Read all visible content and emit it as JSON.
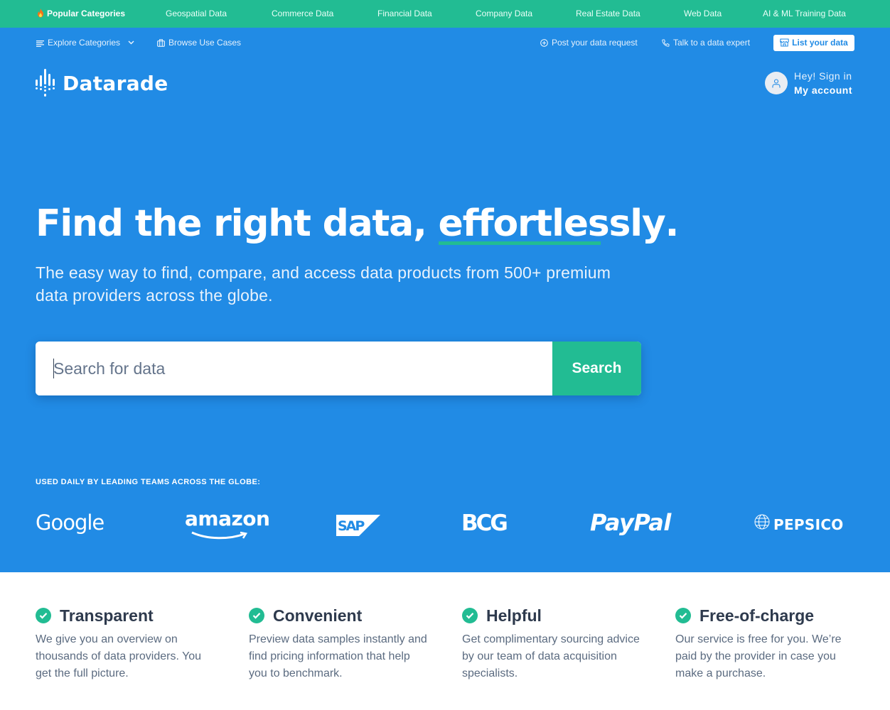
{
  "category_bar": {
    "items": [
      {
        "label": "Popular Categories",
        "icon": "fire-icon",
        "emphasis": true
      },
      {
        "label": "Geospatial Data"
      },
      {
        "label": "Commerce Data"
      },
      {
        "label": "Financial Data"
      },
      {
        "label": "Company Data"
      },
      {
        "label": "Real Estate Data"
      },
      {
        "label": "Web Data"
      },
      {
        "label": "AI & ML Training Data"
      }
    ]
  },
  "sub_nav": {
    "left": [
      {
        "label": "Explore Categories",
        "icon": "menu-lines-icon",
        "has_dropdown": true
      },
      {
        "label": "Browse Use Cases",
        "icon": "briefcase-icon"
      }
    ],
    "right": [
      {
        "label": "Post your data request",
        "icon": "plus-circle-icon"
      },
      {
        "label": "Talk to a data expert",
        "icon": "phone-icon"
      }
    ],
    "cta": {
      "label": "List your data",
      "icon": "storefront-icon"
    }
  },
  "logo": {
    "text": "Datarade"
  },
  "account": {
    "greeting": "Hey! Sign in",
    "label": "My account"
  },
  "hero": {
    "headline_prefix": "Find the right data, ",
    "headline_emphasis": "effortlessly",
    "headline_suffix": ".",
    "subtitle": "The easy way to find, compare, and access data products from 500+ premium data providers across the globe."
  },
  "search": {
    "value": "",
    "placeholder": "Search for data",
    "button_label": "Search"
  },
  "trusted_by": {
    "heading": "USED DAILY BY LEADING TEAMS ACROSS THE GLOBE:",
    "brands": [
      "Google",
      "amazon",
      "SAP",
      "BCG",
      "PayPal",
      "PEPSICO"
    ]
  },
  "features": [
    {
      "title": "Transparent",
      "description": "We give you an overview on thousands of data providers. You get the full picture."
    },
    {
      "title": "Convenient",
      "description": "Preview data samples instantly and find pricing information that help you to benchmark."
    },
    {
      "title": "Helpful",
      "description": "Get complimentary sourcing advice by our team of data acquisition specialists."
    },
    {
      "title": "Free-of-charge",
      "description": "Our service is free for you. We’re paid by the provider in case you make a purchase."
    }
  ],
  "colors": {
    "brand_blue": "#218be5",
    "accent_green": "#22bc93",
    "heading_dark": "#2e3a4d",
    "body_gray": "#5b6b80"
  }
}
